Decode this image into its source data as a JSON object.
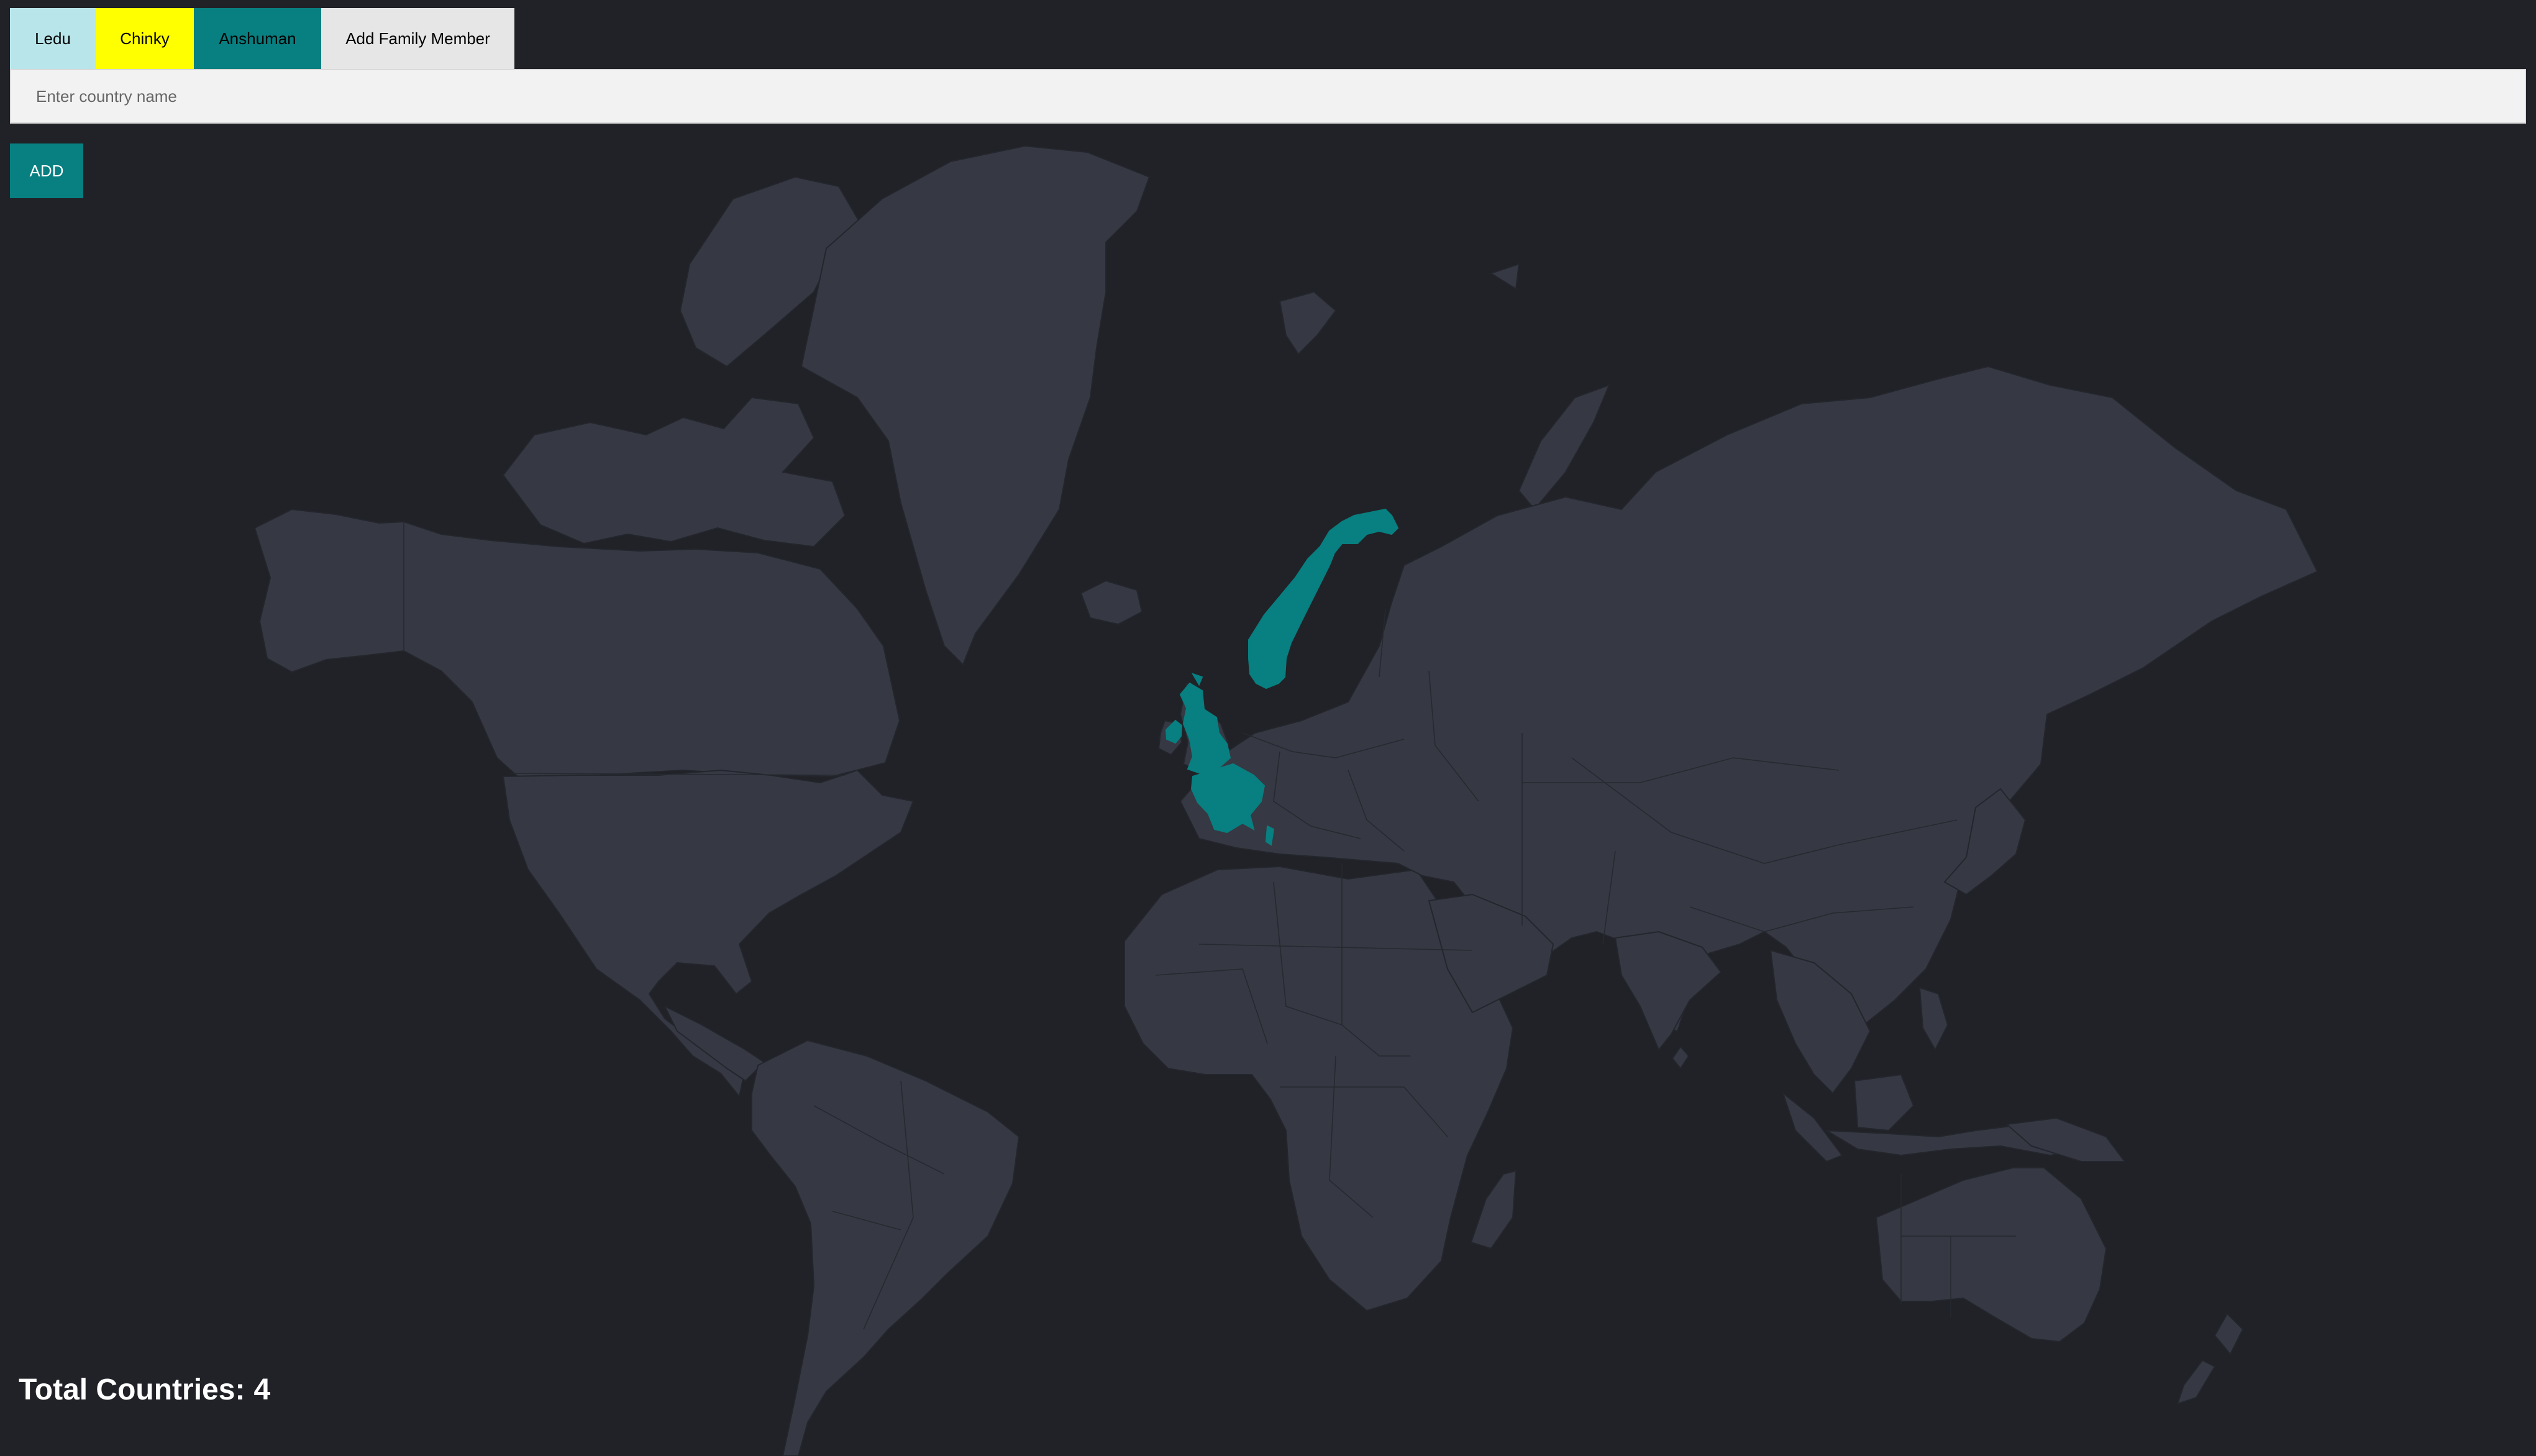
{
  "family_tabs": [
    {
      "label": "Ledu",
      "color": "#b8e5ea",
      "selected": false
    },
    {
      "label": "Chinky",
      "color": "#ffff00",
      "selected": false
    },
    {
      "label": "Anshuman",
      "color": "#087f80",
      "selected": true
    },
    {
      "label": "Add Family Member",
      "color": "#e6e6e6",
      "selected": false
    }
  ],
  "country_input": {
    "placeholder": "Enter country name",
    "value": ""
  },
  "add_button": {
    "label": "ADD",
    "color": "#087f80"
  },
  "map": {
    "land_color": "#363843",
    "highlight_color": "#087f80",
    "highlighted_countries": [
      "Norway",
      "Ireland",
      "United Kingdom",
      "France"
    ]
  },
  "summary": {
    "total_label": "Total Countries:",
    "total_value": "4"
  }
}
